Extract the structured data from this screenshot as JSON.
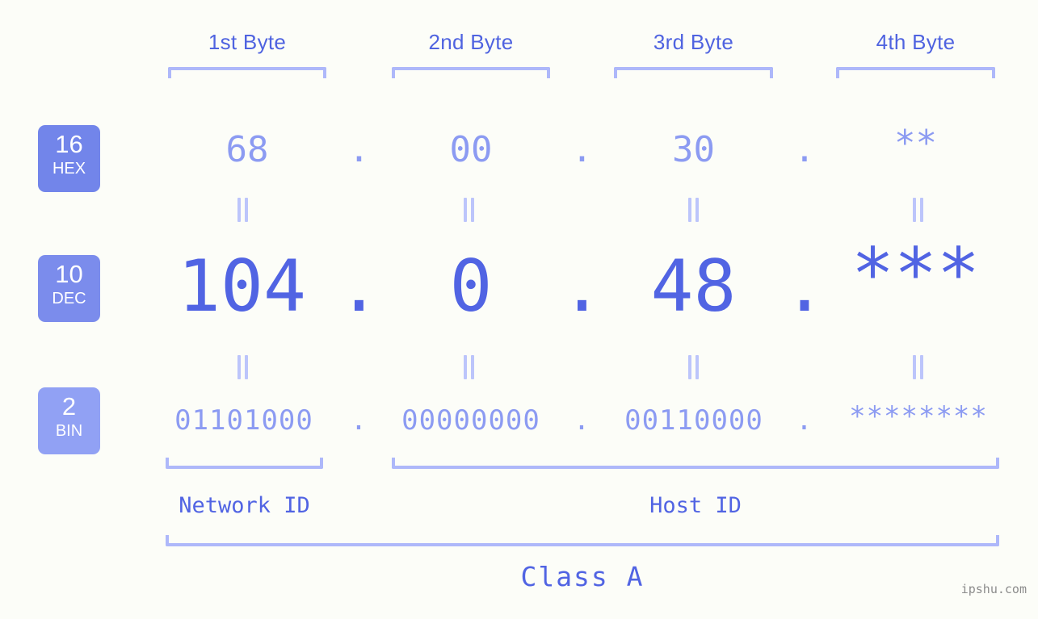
{
  "page": {
    "background_color": "#fcfdf8",
    "accent_color": "#5164e3",
    "light_accent_color": "#8c9bf2",
    "bracket_color": "#aeb8fa",
    "watermark": "ipshu.com"
  },
  "byte_headers": [
    {
      "label": "1st Byte"
    },
    {
      "label": "2nd Byte"
    },
    {
      "label": "3rd Byte"
    },
    {
      "label": "4th Byte"
    }
  ],
  "bases": [
    {
      "number": "16",
      "name": "HEX",
      "color": "#7285ea"
    },
    {
      "number": "10",
      "name": "DEC",
      "color": "#7b8cec"
    },
    {
      "number": "2",
      "name": "BIN",
      "color": "#91a1f4"
    }
  ],
  "rows": {
    "hex": {
      "base_number": "16",
      "base_name": "HEX",
      "values": [
        "68",
        "00",
        "30",
        "**"
      ],
      "separators": [
        ".",
        ".",
        "."
      ]
    },
    "dec": {
      "base_number": "10",
      "base_name": "DEC",
      "values": [
        "104",
        "0",
        "48",
        "***"
      ],
      "separators": [
        ".",
        ".",
        "."
      ]
    },
    "bin": {
      "base_number": "2",
      "base_name": "BIN",
      "values": [
        "01101000",
        "00000000",
        "00110000",
        "********"
      ],
      "separators": [
        ".",
        ".",
        "."
      ]
    }
  },
  "equals_marks": {
    "glyph": "=",
    "count_per_gap": 4
  },
  "sections": {
    "network_id": {
      "label": "Network ID"
    },
    "host_id": {
      "label": "Host ID"
    },
    "class": {
      "label": "Class A"
    }
  }
}
